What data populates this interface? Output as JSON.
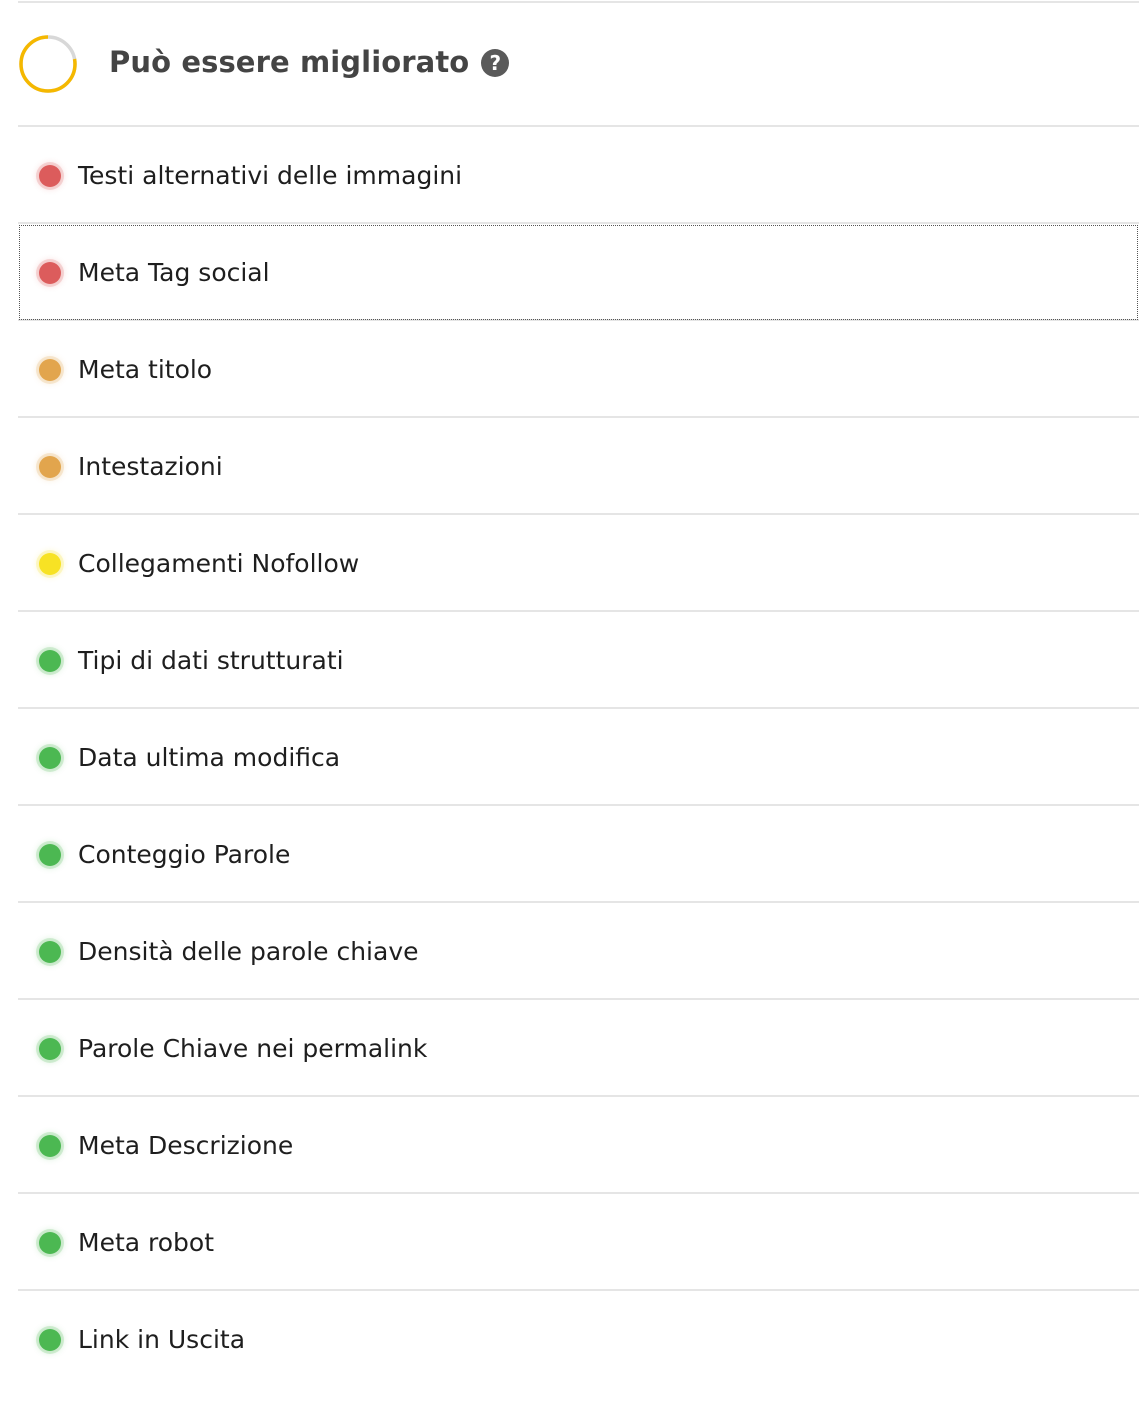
{
  "section": {
    "title": "Può essere migliorato",
    "help_icon": "question-circle-icon",
    "score_ring": {
      "icon": "score-ring-icon",
      "progress": 0.78,
      "color": "#f5b800",
      "track_color": "#d8d8d8"
    }
  },
  "status_colors": {
    "red": "#dc5c5c",
    "orange": "#e2a54d",
    "yellow": "#f7e224",
    "green": "#4cb852"
  },
  "checks": [
    {
      "label": "Testi alternativi delle immagini",
      "status": "red"
    },
    {
      "label": "Meta Tag social",
      "status": "red"
    },
    {
      "label": "Meta titolo",
      "status": "orange"
    },
    {
      "label": "Intestazioni",
      "status": "orange"
    },
    {
      "label": "Collegamenti Nofollow",
      "status": "yellow"
    },
    {
      "label": "Tipi di dati strutturati",
      "status": "green"
    },
    {
      "label": "Data ultima modifica",
      "status": "green"
    },
    {
      "label": "Conteggio Parole",
      "status": "green"
    },
    {
      "label": "Densità delle parole chiave",
      "status": "green"
    },
    {
      "label": "Parole Chiave nei permalink",
      "status": "green"
    },
    {
      "label": "Meta Descrizione",
      "status": "green"
    },
    {
      "label": "Meta robot",
      "status": "green"
    },
    {
      "label": "Link in Uscita",
      "status": "green"
    }
  ]
}
